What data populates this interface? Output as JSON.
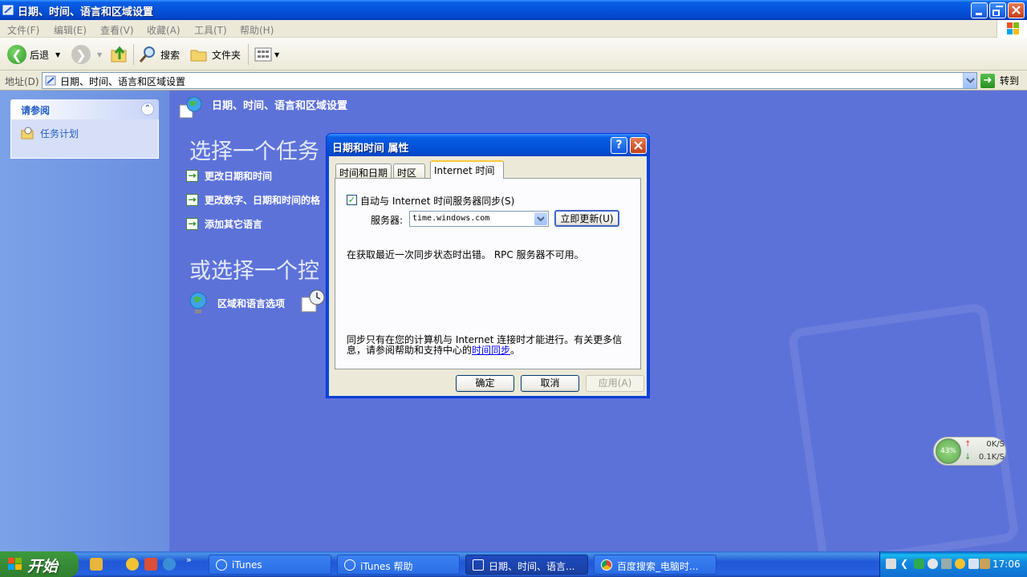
{
  "window": {
    "title": "日期、时间、语言和区域设置"
  },
  "menu": [
    "文件(F)",
    "编辑(E)",
    "查看(V)",
    "收藏(A)",
    "工具(T)",
    "帮助(H)"
  ],
  "toolbar": {
    "back_label": "后退",
    "search_label": "搜索",
    "folders_label": "文件夹"
  },
  "address": {
    "label": "地址(D)",
    "value": "日期、时间、语言和区域设置",
    "go_label": "转到"
  },
  "sidebar": {
    "see_also": "请参阅",
    "items": [
      {
        "label": "任务计划"
      }
    ]
  },
  "category": {
    "title": "日期、时间、语言和区域设置",
    "pick_task": "选择一个任务",
    "tasks": [
      {
        "label": "更改日期和时间"
      },
      {
        "label": "更改数字、日期和时间的格"
      },
      {
        "label": "添加其它语言"
      }
    ],
    "or_pick": "或选择一个控",
    "control_panel_icons": [
      {
        "label": "区域和语言选项"
      }
    ]
  },
  "dialog": {
    "title": "日期和时间 属性",
    "tabs": [
      "时间和日期",
      "时区",
      "Internet 时间"
    ],
    "active_tab": 2,
    "auto_sync_label": "自动与 Internet 时间服务器同步(S)",
    "auto_sync_checked": true,
    "server_label": "服务器:",
    "server_value": "time.windows.com",
    "update_now_label": "立即更新(U)",
    "status_text": "在获取最近一次同步状态时出错。 RPC 服务器不可用。",
    "note_text": "同步只有在您的计算机与 Internet 连接时才能进行。有关更多信息，请参阅帮助和支持中心的",
    "note_link": "时间同步",
    "note_end": "。",
    "ok_label": "确定",
    "cancel_label": "取消",
    "apply_label": "应用(A)"
  },
  "net_monitor": {
    "percent": "43%",
    "upload": "0K/S",
    "download": "0.1K/S"
  },
  "taskbar": {
    "start_label": "开始",
    "buttons": [
      {
        "label": "iTunes"
      },
      {
        "label": "iTunes 帮助"
      },
      {
        "label": "日期、时间、语言..."
      },
      {
        "label": "百度搜索_电脑时..."
      }
    ],
    "active_button": 2,
    "clock": "17:06"
  },
  "colors": {
    "xp_blue": "#0453da",
    "main_bg": "#5d72d9",
    "sidebar_bg": "#7ba2e7",
    "link_blue": "#215dc6",
    "start_green": "#388e38"
  }
}
